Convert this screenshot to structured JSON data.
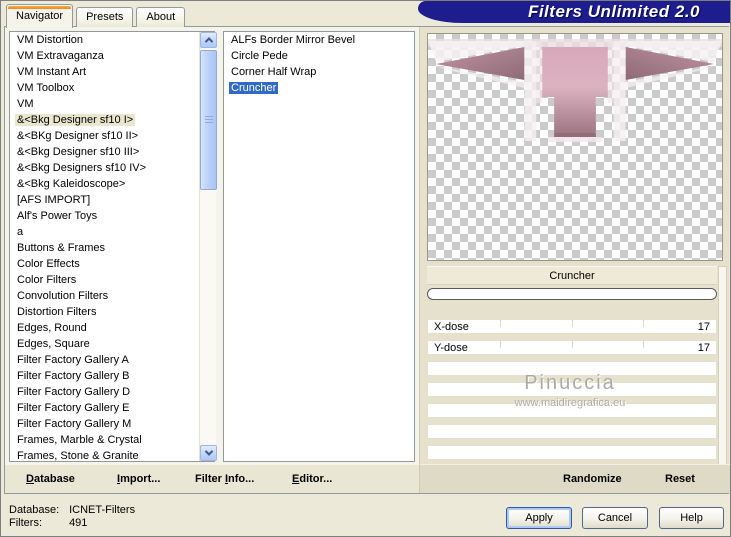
{
  "window": {
    "title": "Filters Unlimited 2.0",
    "background": "#ECE9D8",
    "banner_color": "#1E1D8E"
  },
  "tabs": {
    "navigator": "Navigator",
    "presets": "Presets",
    "about": "About",
    "active": "Navigator"
  },
  "category_panel": {
    "items": [
      "VM Distortion",
      "VM Extravaganza",
      "VM Instant Art",
      "VM Toolbox",
      "VM",
      "&<Bkg Designer sf10 I>",
      "&<BKg Designer sf10 II>",
      "&<Bkg Designer sf10 III>",
      "&<Bkg Designers sf10 IV>",
      "&<Bkg Kaleidoscope>",
      "[AFS IMPORT]",
      "Alf's Power Toys",
      "a",
      "Buttons & Frames",
      "Color Effects",
      "Color Filters",
      "Convolution Filters",
      "Distortion Filters",
      "Edges, Round",
      "Edges, Square",
      "Filter Factory Gallery A",
      "Filter Factory Gallery B",
      "Filter Factory Gallery D",
      "Filter Factory Gallery E",
      "Filter Factory Gallery M",
      "Frames, Marble & Crystal",
      "Frames, Stone & Granite"
    ],
    "selected_index": 5
  },
  "filter_panel": {
    "items": [
      "ALFs Border Mirror Bevel",
      "Circle Pede",
      "Corner Half Wrap",
      "Cruncher"
    ],
    "selected_index": 3
  },
  "preview": {
    "title": "Cruncher",
    "shape_colors": {
      "light": "#DCAEBE",
      "dark": "#9B7381",
      "checker": "#CBCBCB"
    }
  },
  "parameters": {
    "rows": [
      {
        "name": "X-dose",
        "value": "17"
      },
      {
        "name": "Y-dose",
        "value": "17"
      }
    ],
    "empty_row_count": 6
  },
  "watermark": {
    "name": "Pinuccia",
    "url": "www.maidiregrafica.eu"
  },
  "toolbar": {
    "database": {
      "pre": "",
      "u": "D",
      "post": "atabase"
    },
    "import": {
      "pre": "",
      "u": "I",
      "post": "mport..."
    },
    "filter_info": {
      "pre": "Filter ",
      "u": "I",
      "post": "nfo..."
    },
    "editor": {
      "pre": "",
      "u": "E",
      "post": "ditor..."
    }
  },
  "actions": {
    "randomize": "Randomize",
    "reset": "Reset"
  },
  "status": {
    "database_label": "Database:",
    "database_value": "ICNET-Filters",
    "filters_label": "Filters:",
    "filters_value": "491"
  },
  "dialog": {
    "apply": "Apply",
    "cancel": "Cancel",
    "help": "Help"
  },
  "colors": {
    "selection": "#316AC5",
    "tab_accent": "#F59A23"
  }
}
